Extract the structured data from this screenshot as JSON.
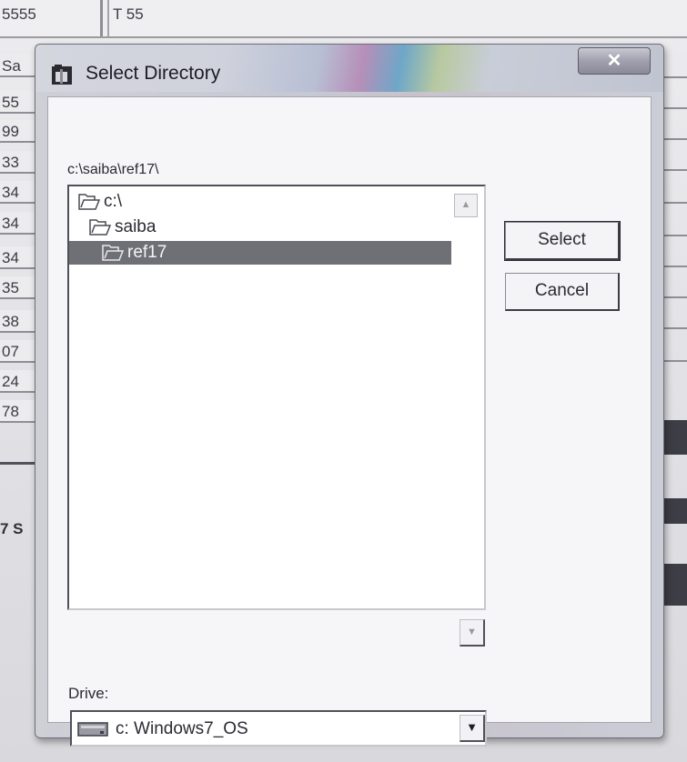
{
  "background": {
    "header_cells": [
      "5555",
      "T 55"
    ],
    "column_header": "Sa",
    "column_values": [
      "55",
      "99",
      "33",
      "34",
      "34",
      "34",
      "35",
      "38",
      "07",
      "24",
      "78"
    ],
    "side_text": "7 S"
  },
  "dialog": {
    "title": "Select Directory",
    "title_icon": "folder-app-icon",
    "close_label": "✕",
    "current_path": "c:\\saiba\\ref17\\",
    "directories": [
      {
        "label": "c:\\",
        "icon": "open-folder-icon",
        "selected": false
      },
      {
        "label": "saiba",
        "icon": "open-folder-icon",
        "selected": false
      },
      {
        "label": "ref17",
        "icon": "open-folder-icon",
        "selected": true
      }
    ],
    "select_label": "Select",
    "cancel_label": "Cancel",
    "drive_label": "Drive:",
    "drive_value": "c: Windows7_OS",
    "drive_icon": "hard-drive-icon",
    "scroll_up_arrow": "▲",
    "scroll_down_arrow": "▼",
    "dropdown_arrow": "▼"
  }
}
